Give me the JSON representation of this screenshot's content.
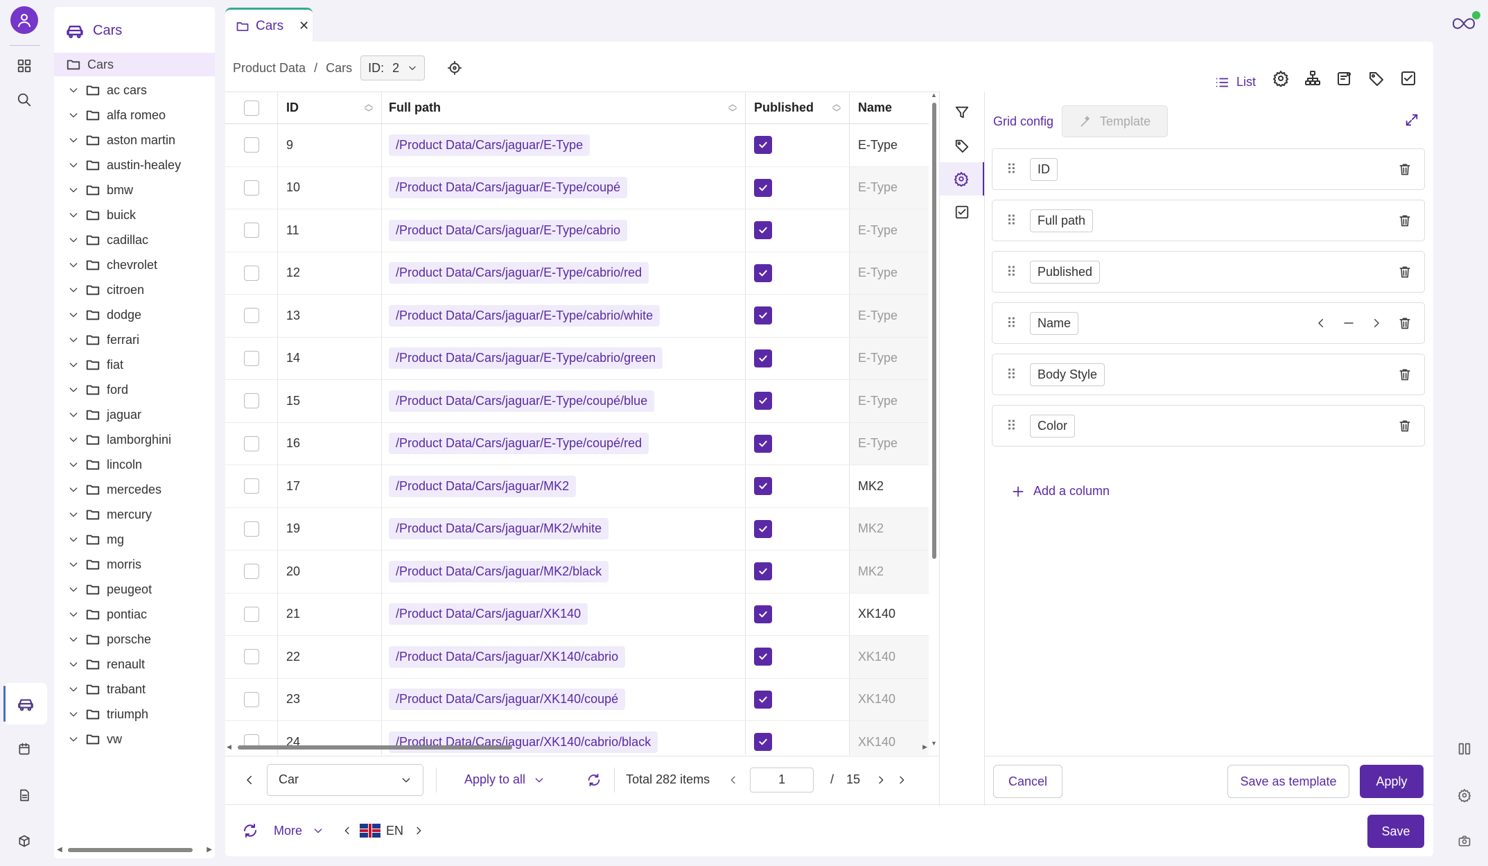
{
  "rail": {
    "icons": [
      "user-icon",
      "grid-icon",
      "search-icon",
      "car-icon",
      "calendar-icon",
      "document-icon",
      "cube-icon"
    ]
  },
  "tree": {
    "title": "Cars",
    "root": "Cars",
    "items": [
      "ac cars",
      "alfa romeo",
      "aston martin",
      "austin-healey",
      "bmw",
      "buick",
      "cadillac",
      "chevrolet",
      "citroen",
      "dodge",
      "ferrari",
      "fiat",
      "ford",
      "jaguar",
      "lamborghini",
      "lincoln",
      "mercedes",
      "mercury",
      "mg",
      "morris",
      "peugeot",
      "pontiac",
      "porsche",
      "renault",
      "trabant",
      "triumph",
      "vw"
    ]
  },
  "tab": {
    "label": "Cars",
    "close": "✕"
  },
  "breadcrumb": {
    "root": "Product Data",
    "sep": "/",
    "current": "Cars",
    "id_label": "ID:",
    "id_value": "2"
  },
  "toolbar": {
    "list_label": "List"
  },
  "grid": {
    "headers": {
      "id": "ID",
      "path": "Full path",
      "published": "Published",
      "name": "Name"
    },
    "rows": [
      {
        "id": "9",
        "path": "/Product Data/Cars/jaguar/E-Type",
        "published": true,
        "name": "E-Type",
        "inherited": false
      },
      {
        "id": "10",
        "path": "/Product Data/Cars/jaguar/E-Type/coupé",
        "published": true,
        "name": "E-Type",
        "inherited": true
      },
      {
        "id": "11",
        "path": "/Product Data/Cars/jaguar/E-Type/cabrio",
        "published": true,
        "name": "E-Type",
        "inherited": true
      },
      {
        "id": "12",
        "path": "/Product Data/Cars/jaguar/E-Type/cabrio/red",
        "published": true,
        "name": "E-Type",
        "inherited": true
      },
      {
        "id": "13",
        "path": "/Product Data/Cars/jaguar/E-Type/cabrio/white",
        "published": true,
        "name": "E-Type",
        "inherited": true
      },
      {
        "id": "14",
        "path": "/Product Data/Cars/jaguar/E-Type/cabrio/green",
        "published": true,
        "name": "E-Type",
        "inherited": true
      },
      {
        "id": "15",
        "path": "/Product Data/Cars/jaguar/E-Type/coupé/blue",
        "published": true,
        "name": "E-Type",
        "inherited": true
      },
      {
        "id": "16",
        "path": "/Product Data/Cars/jaguar/E-Type/coupé/red",
        "published": true,
        "name": "E-Type",
        "inherited": true
      },
      {
        "id": "17",
        "path": "/Product Data/Cars/jaguar/MK2",
        "published": true,
        "name": "MK2",
        "inherited": false
      },
      {
        "id": "19",
        "path": "/Product Data/Cars/jaguar/MK2/white",
        "published": true,
        "name": "MK2",
        "inherited": true
      },
      {
        "id": "20",
        "path": "/Product Data/Cars/jaguar/MK2/black",
        "published": true,
        "name": "MK2",
        "inherited": true
      },
      {
        "id": "21",
        "path": "/Product Data/Cars/jaguar/XK140",
        "published": true,
        "name": "XK140",
        "inherited": false
      },
      {
        "id": "22",
        "path": "/Product Data/Cars/jaguar/XK140/cabrio",
        "published": true,
        "name": "XK140",
        "inherited": true
      },
      {
        "id": "23",
        "path": "/Product Data/Cars/jaguar/XK140/coupé",
        "published": true,
        "name": "XK140",
        "inherited": true
      },
      {
        "id": "24",
        "path": "/Product Data/Cars/jaguar/XK140/cabrio/black",
        "published": true,
        "name": "XK140",
        "inherited": true
      }
    ]
  },
  "grid_footer": {
    "class_select": "Car",
    "apply_all": "Apply to all",
    "total": "Total 282 items",
    "page": "1",
    "of": "/",
    "pages": "15"
  },
  "config": {
    "title": "Grid config",
    "template_btn": "Template",
    "columns": [
      "ID",
      "Full path",
      "Published",
      "Name",
      "Body Style",
      "Color"
    ],
    "add_column": "Add a column",
    "cancel": "Cancel",
    "save_template": "Save as template",
    "apply": "Apply"
  },
  "bottom": {
    "more": "More",
    "lang": "EN",
    "save": "Save"
  },
  "colors": {
    "accent": "#5a2aa6",
    "tab_border": "#37a98f",
    "status": "#3fbf5a"
  }
}
